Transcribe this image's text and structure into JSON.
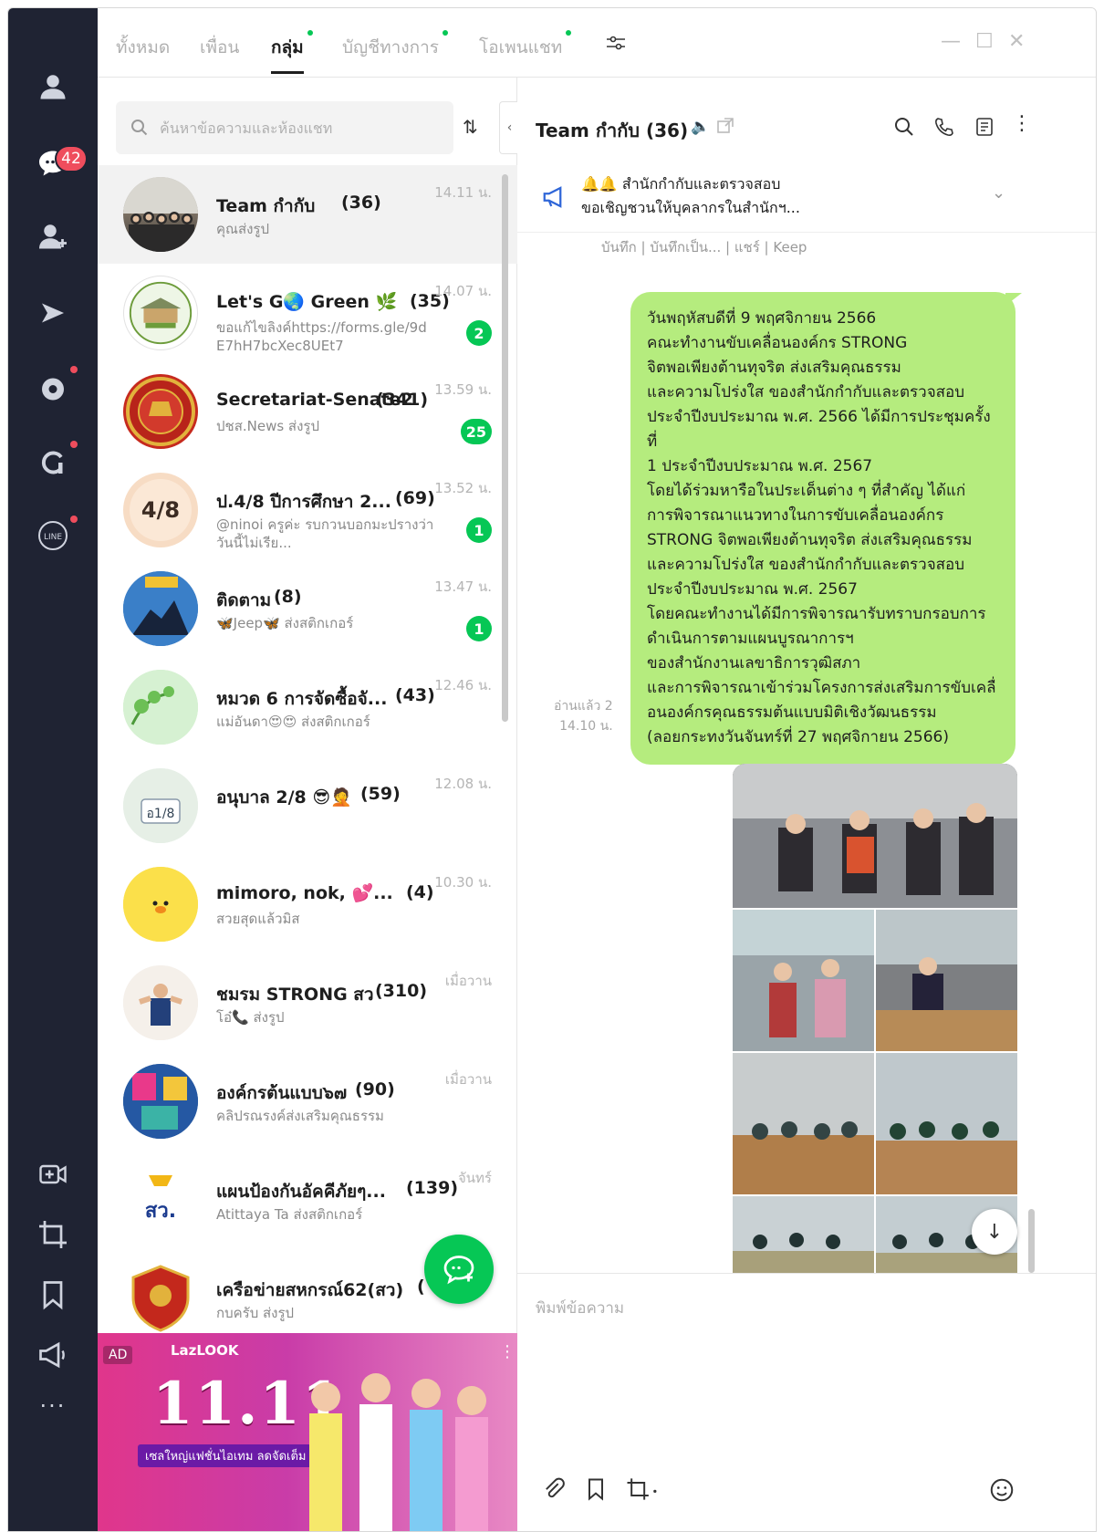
{
  "rail": {
    "chat_badge": "42"
  },
  "tabs": [
    {
      "label": "ทั้งหมด",
      "dot": false
    },
    {
      "label": "เพื่อน",
      "dot": false
    },
    {
      "label": "กลุ่ม",
      "dot": true,
      "active": true
    },
    {
      "label": "บัญชีทางการ",
      "dot": true
    },
    {
      "label": "โอเพนแชท",
      "dot": true
    }
  ],
  "search": {
    "placeholder": "ค้นหาข้อความและห้องแชท"
  },
  "chats": [
    {
      "name": "Team กำกับ",
      "count": "(36)",
      "preview": "คุณส่งรูป",
      "time": "14.11 น.",
      "unread": ""
    },
    {
      "name": "Let's G🌏 Green 🌿",
      "count": "(35)",
      "preview": "ขอแก้ไขลิงค์https://forms.gle/9dE7hH7bcXec8UEt7",
      "time": "14.07 น.",
      "unread": "2"
    },
    {
      "name": "Secretariat-Senate2",
      "count": "(341)",
      "preview": "ปชส.News ส่งรูป",
      "time": "13.59 น.",
      "unread": "25"
    },
    {
      "name": "ป.4/8 ปีการศึกษา 2...",
      "count": "(69)",
      "preview": "@ninoi ครูค่ะ รบกวนบอกมะปรางว่าวันนี้ไม่เรีย...",
      "time": "13.52 น.",
      "unread": "1"
    },
    {
      "name": "ติดตาม",
      "count": "(8)",
      "preview": "🦋Jeep🦋 ส่งสติกเกอร์",
      "time": "13.47 น.",
      "unread": "1"
    },
    {
      "name": "หมวด 6 การจัดซื้อจั...",
      "count": "(43)",
      "preview": "แม่อันดา😍😍 ส่งสติกเกอร์",
      "time": "12.46 น.",
      "unread": ""
    },
    {
      "name": "อนุบาล 2/8 😎🤦",
      "count": "(59)",
      "preview": "",
      "time": "12.08 น.",
      "unread": ""
    },
    {
      "name": "mimoro, nok, 💕...",
      "count": "(4)",
      "preview": "สวยสุดแล้วมิส",
      "time": "10.30 น.",
      "unread": ""
    },
    {
      "name": "ชมรม STRONG สว",
      "count": "(310)",
      "preview": "โอ๋📞 ส่งรูป",
      "time": "เมื่อวาน",
      "unread": ""
    },
    {
      "name": "องค์กรต้นแบบ๖๗",
      "count": "(90)",
      "preview": "คลิปรณรงค์ส่งเสริมคุณธรรม",
      "time": "เมื่อวาน",
      "unread": ""
    },
    {
      "name": "แผนป้องกันอัคคีภัยๆ...",
      "count": "(139)",
      "preview": "Atittaya Ta ส่งสติกเกอร์",
      "time": "จันทร์",
      "unread": ""
    },
    {
      "name": "เครือข่ายสหกรณ์62(สว)",
      "count": "(",
      "preview": "กบครับ ส่งรูป",
      "time": "",
      "unread": ""
    }
  ],
  "ad": {
    "label": "AD",
    "brand": "LazLOOK",
    "big": "11.11",
    "sub": "เซลใหญ่แฟชั่นไอเทม ลดจัดเต็ม"
  },
  "conversation": {
    "title": "Team กำกับ",
    "count": "(36)",
    "announcement_line1": "🔔🔔 สำนักกำกับและตรวจสอบ",
    "announcement_line2": "ขอเชิญชวนให้บุคลากรในสำนักฯ...",
    "announcement_actions": "บันทึก | บันทึกเป็น... | แชร์ | Keep",
    "message_lines": [
      "วันพฤหัสบดีที่ 9 พฤศจิกายน 2566",
      "คณะทำงานขับเคลื่อนองค์กร STRONG",
      "จิตพอเพียงต้านทุจริต ส่งเสริมคุณธรรม",
      "และความโปร่งใส ของสำนักกำกับและตรวจสอบ",
      "ประจำปีงบประมาณ พ.ศ. 2566 ได้มีการประชุมครั้งที่",
      "1 ประจำปีงบประมาณ พ.ศ. 2567",
      "โดยได้ร่วมหารือในประเด็นต่าง ๆ ที่สำคัญ ได้แก่",
      "การพิจารณาแนวทางในการขับเคลื่อนองค์กร",
      "STRONG จิตพอเพียงต้านทุจริต ส่งเสริมคุณธรรม",
      "และความโปร่งใส ของสำนักกำกับและตรวจสอบ",
      "ประจำปีงบประมาณ พ.ศ. 2567",
      "โดยคณะทำงานได้มีการพิจารณารับทราบกรอบการ",
      "ดำเนินการตามแผนบูรณาการฯ",
      "ของสำนักงานเลขาธิการวุฒิสภา",
      "และการพิจารณาเข้าร่วมโครงการส่งเสริมการขับเคลื่",
      "อนองค์กรคุณธรรมต้นแบบมิติเชิงวัฒนธรรม",
      "(ลอยกระทงวันจันทร์ที่ 27 พฤศจิกายน 2566)"
    ],
    "read_status": "อ่านแล้ว 2",
    "message_time": "14.10 น.",
    "composer_placeholder": "พิมพ์ข้อความ"
  },
  "colors": {
    "rail_bg": "#1f2333",
    "line_green": "#06c755",
    "bubble_green": "#b5ec7e",
    "badge_red": "#ef4d5d"
  }
}
